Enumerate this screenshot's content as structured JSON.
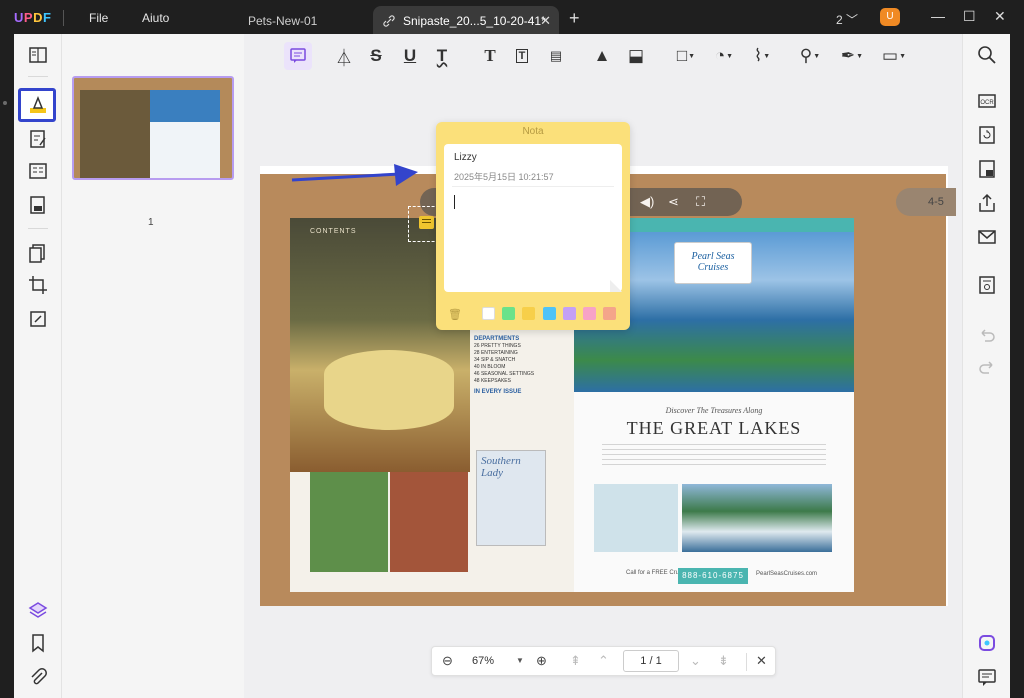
{
  "app": {
    "logo": "UPDF"
  },
  "menu": {
    "file": "File",
    "help": "Aiuto"
  },
  "tabs": [
    {
      "label": "Pets-New-01",
      "active": false
    },
    {
      "label": "Snipaste_20...5_10-20-41*",
      "active": true
    }
  ],
  "titlebar": {
    "doc_count": "2",
    "avatar_letter": "U"
  },
  "thumbnail": {
    "page_number": "1"
  },
  "note": {
    "title": "Nota",
    "author": "Lizzy",
    "date": "2025年5月15日 10:21:57",
    "colors": [
      "#ffffff",
      "#6be28a",
      "#f7cf4a",
      "#4fc3f7",
      "#c4a0f5",
      "#f7a3c6",
      "#f4a58a"
    ]
  },
  "document": {
    "left_page": {
      "contents_label": "CONTENTS",
      "departments": "DEPARTMENTS",
      "in_every_issue": "IN EVERY ISSUE",
      "magazine": "Southern Lady"
    },
    "right_page": {
      "brand": "Pearl Seas Cruises",
      "discover": "Discover The Treasures Along",
      "headline": "THE GREAT LAKES",
      "call": "Call for a FREE Cruise Guide",
      "phone": "888-610-6875",
      "website": "PearlSeasCruises.com"
    },
    "page_indicator": "4-5"
  },
  "zoombar": {
    "zoom": "67%",
    "page": "1 / 1"
  },
  "accent": "#7b4be0",
  "highlight_border": "#3344cc"
}
